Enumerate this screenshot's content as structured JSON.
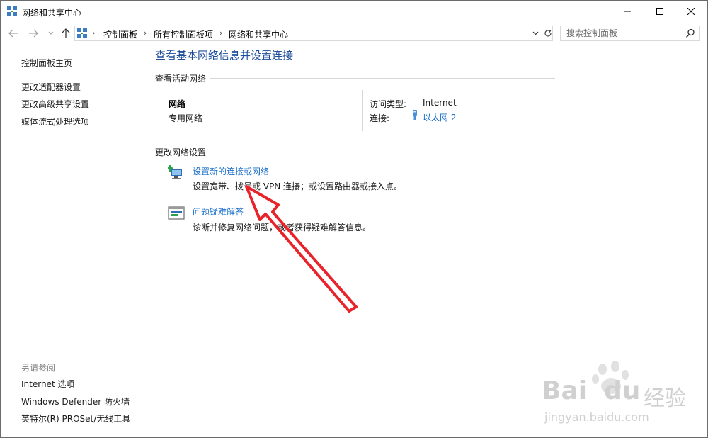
{
  "window": {
    "title": "网络和共享中心",
    "minimize_glyph": "—",
    "maximize_glyph": "☐",
    "close_glyph": "✕"
  },
  "address_bar": {
    "breadcrumbs": [
      "控制面板",
      "所有控制面板项",
      "网络和共享中心"
    ],
    "separator": "›",
    "search_placeholder": "搜索控制面板"
  },
  "left_pane": {
    "links": [
      "控制面板主页",
      "更改适配器设置",
      "更改高级共享设置",
      "媒体流式处理选项"
    ],
    "see_also_title": "另请参阅",
    "see_also_links": [
      "Internet 选项",
      "Windows Defender 防火墙",
      "英特尔(R) PROSet/无线工具"
    ]
  },
  "main": {
    "title": "查看基本网络信息并设置连接",
    "active_networks_heading": "查看活动网络",
    "network": {
      "name": "网络",
      "type": "专用网络",
      "access_type_label": "访问类型:",
      "access_type_value": "Internet",
      "connection_label": "连接:",
      "connection_value": "以太网 2"
    },
    "change_settings_heading": "更改网络设置",
    "tasks": [
      {
        "title": "设置新的连接或网络",
        "description": "设置宽带、拨号或 VPN 连接；或设置路由器或接入点。"
      },
      {
        "title": "问题疑难解答",
        "description": "诊断并修复网络问题，或者获得疑难解答信息。"
      }
    ]
  },
  "watermark": {
    "brand": "Bai",
    "brand_suffix": "du",
    "cn": "经验",
    "url": "jingyan.baidu.com"
  },
  "colors": {
    "link": "#1a6fc9",
    "title": "#1f4e9c",
    "annotation_arrow": "#e8232a"
  }
}
